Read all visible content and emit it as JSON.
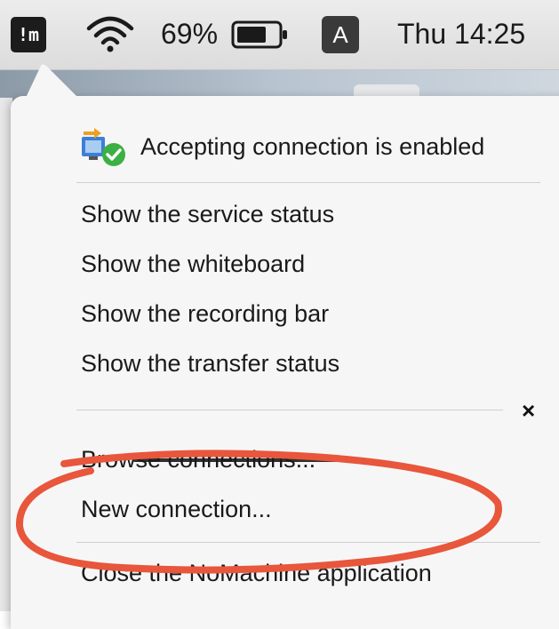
{
  "menubar": {
    "app_icon_label": "!m",
    "battery_percent": "69%",
    "input_source": "A",
    "clock": "Thu 14:25"
  },
  "menu": {
    "status": "Accepting connection is enabled",
    "items": [
      "Show the service status",
      "Show the whiteboard",
      "Show the recording bar",
      "Show the transfer status"
    ],
    "close_symbol": "×",
    "browse": "Browse connections...",
    "new_connection": "New connection...",
    "quit": "Close the NoMachine application"
  },
  "colors": {
    "annotation": "#e8563c",
    "status_green": "#3cb043",
    "status_blue": "#3d7fd6",
    "menu_bg": "#f6f6f6"
  },
  "icons": {
    "app": "nomachine-icon",
    "wifi": "wifi-icon",
    "battery": "battery-icon",
    "input": "input-source-icon",
    "status": "connection-status-icon",
    "close": "close-icon"
  }
}
